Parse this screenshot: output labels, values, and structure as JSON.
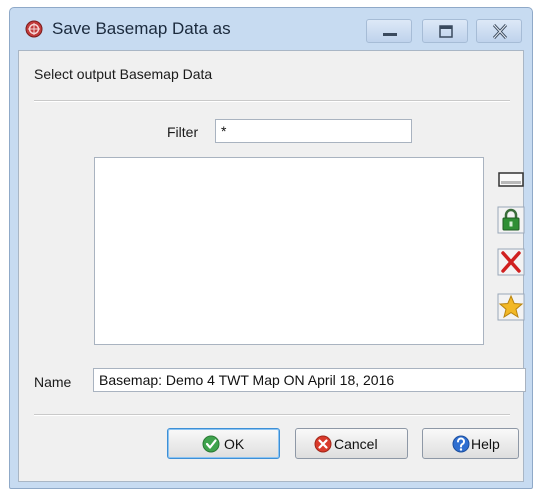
{
  "window": {
    "title": "Save Basemap Data as",
    "controls": [
      "minimize-icon",
      "maximize-icon",
      "close-icon"
    ],
    "colors": {
      "frame": "#c7dbf1",
      "client": "#f0f0f0"
    }
  },
  "dialog": {
    "heading": "Select output Basemap Data",
    "filter_label": "Filter",
    "filter_value": "*",
    "list_items": [],
    "side_buttons": [
      "rename-icon",
      "lock-icon",
      "delete-icon",
      "favorite-icon"
    ],
    "name_label": "Name",
    "name_value": "Basemap: Demo 4 TWT Map ON April 18, 2016"
  },
  "buttons": {
    "ok": "OK",
    "cancel": "Cancel",
    "help": "Help"
  }
}
